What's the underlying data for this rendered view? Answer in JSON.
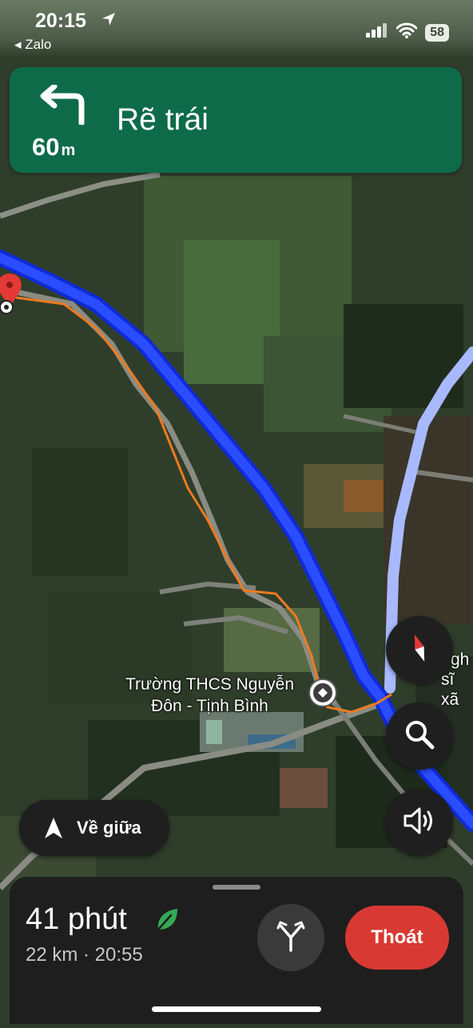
{
  "status_bar": {
    "time": "20:15",
    "back_app": "◂ Zalo",
    "battery": "58",
    "icons": [
      "location-arrow-icon",
      "signal-icon",
      "wifi-icon",
      "battery-icon"
    ]
  },
  "nav_banner": {
    "instruction": "Rẽ trái",
    "distance_value": "60",
    "distance_unit": "m",
    "icon": "turn-left-arrow-icon",
    "background_color": "#0e6b4a"
  },
  "map": {
    "place_label_line1": "Trường THCS Nguyễn",
    "place_label_line2": "Đôn - Tịnh Bình",
    "edge_label_line1": "gh",
    "edge_label_line2": "sĩ xã",
    "route_color": "#1a3cff",
    "alt_route_color": "#a9b9ff",
    "track_color": "#f07a1e",
    "icons": [
      "destination-pin-icon",
      "school-icon"
    ]
  },
  "controls": {
    "compass": "compass-icon",
    "search": "search-icon",
    "sound": "sound-icon",
    "recenter_label": "Về giữa"
  },
  "trip": {
    "duration": "41 phút",
    "summary": "22 km · 20:55",
    "exit_label": "Thoát",
    "icons": [
      "eco-leaf-icon",
      "alternate-routes-icon"
    ]
  }
}
